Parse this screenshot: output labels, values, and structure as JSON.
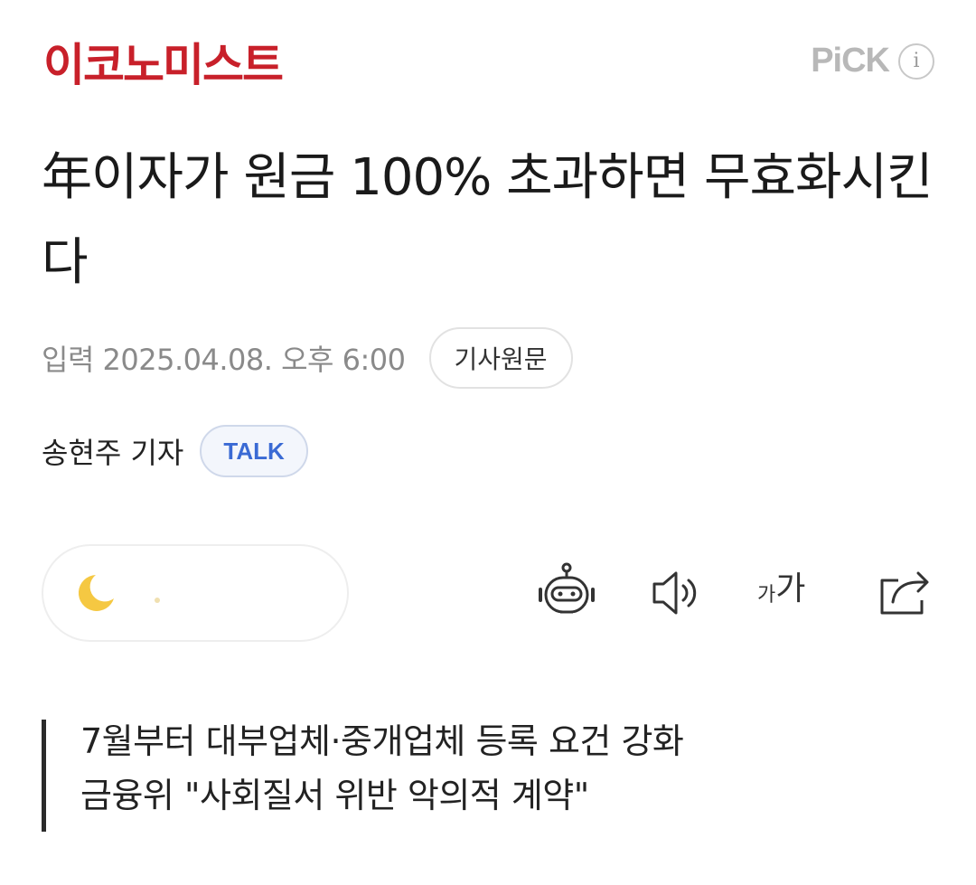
{
  "header": {
    "press_name": "이코노미스트",
    "pick_label": "PiCK",
    "info_icon": "i"
  },
  "article": {
    "title": "年이자가 원금 100% 초과하면 무효화시킨다",
    "date_text": "입력 2025.04.08. 오후 6:00",
    "original_button": "기사원문",
    "reporter": "송현주 기자",
    "talk_button": "TALK",
    "subheadings": [
      "7월부터 대부업체·중개업체 등록 요건 강화",
      "금융위 \"사회질서 위반 악의적 계약\""
    ]
  },
  "toolbar": {
    "font_size_small": "가",
    "font_size_large": "가",
    "icons": [
      "ai-summary-robot-icon",
      "speaker-icon",
      "font-size-icon",
      "share-icon"
    ]
  },
  "colors": {
    "press_red": "#c8202a",
    "talk_blue": "#3a6ad4",
    "date_gray": "#8a8a8a",
    "reaction_yellow": "#f5c842"
  }
}
